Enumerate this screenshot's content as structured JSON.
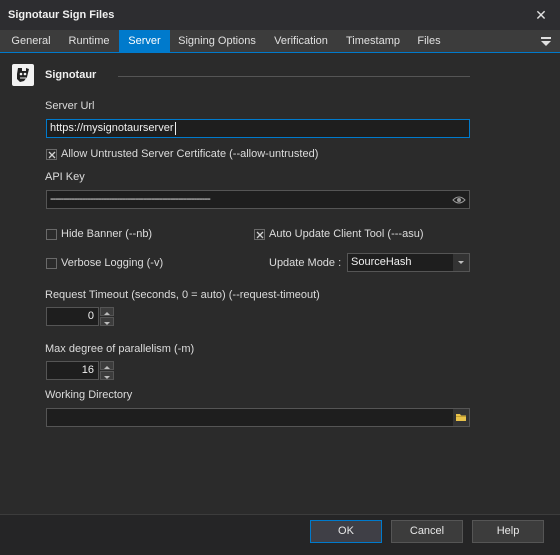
{
  "window": {
    "title": "Signotaur Sign Files"
  },
  "tabs": [
    "General",
    "Runtime",
    "Server",
    "Signing Options",
    "Verification",
    "Timestamp",
    "Files"
  ],
  "section": {
    "title": "Signotaur"
  },
  "server_url": {
    "label": "Server Url",
    "value": "https://mysignotaurserver"
  },
  "allow_untrusted": {
    "label": "Allow Untrusted Server Certificate (--allow-untrusted)",
    "checked": true
  },
  "api_key": {
    "label": "API Key",
    "value": "------------------------------------------------------------"
  },
  "hide_banner": {
    "label": "Hide Banner (--nb)",
    "checked": false
  },
  "auto_update": {
    "label": "Auto Update Client Tool (---asu)",
    "checked": true
  },
  "verbose": {
    "label": "Verbose Logging (-v)",
    "checked": false
  },
  "update_mode": {
    "label": "Update Mode :",
    "value": "SourceHash"
  },
  "request_timeout": {
    "label": "Request Timeout (seconds, 0 = auto)  (--request-timeout)",
    "value": "0"
  },
  "parallelism": {
    "label": "Max degree of parallelism (-m)",
    "value": "16"
  },
  "working_dir": {
    "label": "Working Directory",
    "value": ""
  },
  "buttons": {
    "ok": "OK",
    "cancel": "Cancel",
    "help": "Help"
  },
  "colors": {
    "accent": "#007acc",
    "background": "#2b2b2b",
    "input_bg": "#1e1e1e"
  }
}
